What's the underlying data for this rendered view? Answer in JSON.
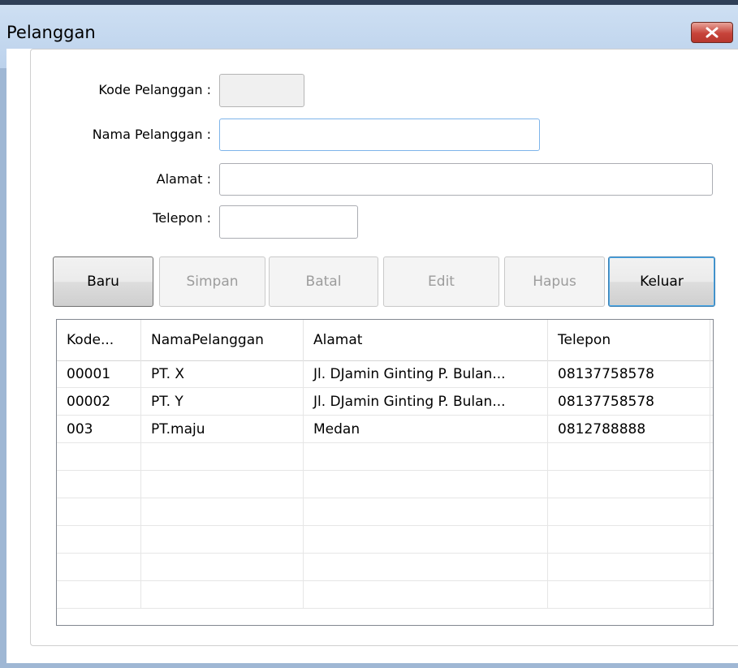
{
  "window": {
    "title": "Pelanggan"
  },
  "form": {
    "kode": {
      "label": "Kode Pelanggan :",
      "value": ""
    },
    "nama": {
      "label": "Nama Pelanggan :",
      "value": ""
    },
    "alamat": {
      "label": "Alamat :",
      "value": ""
    },
    "telepon": {
      "label": "Telepon :",
      "value": ""
    }
  },
  "buttons": {
    "baru": "Baru",
    "simpan": "Simpan",
    "batal": "Batal",
    "edit": "Edit",
    "hapus": "Hapus",
    "keluar": "Keluar"
  },
  "grid": {
    "columns": [
      "Kode...",
      "NamaPelanggan",
      "Alamat",
      "Telepon"
    ],
    "rows": [
      [
        "00001",
        "PT. X",
        "Jl. DJamin Ginting P. Bulan...",
        "08137758578"
      ],
      [
        "00002",
        "PT. Y",
        "Jl. DJamin Ginting P. Bulan...",
        "08137758578"
      ],
      [
        "003",
        "PT.maju",
        "Medan",
        "0812788888"
      ],
      [
        "",
        "",
        "",
        ""
      ],
      [
        "",
        "",
        "",
        ""
      ],
      [
        "",
        "",
        "",
        ""
      ],
      [
        "",
        "",
        "",
        ""
      ],
      [
        "",
        "",
        "",
        ""
      ],
      [
        "",
        "",
        "",
        ""
      ]
    ]
  }
}
